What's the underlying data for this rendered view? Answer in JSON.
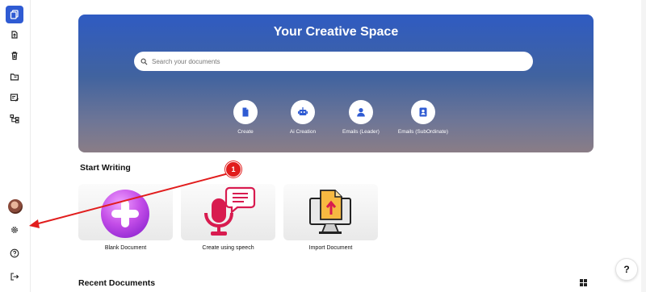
{
  "hero": {
    "title": "Your Creative Space",
    "search_placeholder": "Search your documents",
    "actions": [
      {
        "label": "Create",
        "icon": "document-icon"
      },
      {
        "label": "Ai Creation",
        "icon": "robot-icon"
      },
      {
        "label": "Emails (Leader)",
        "icon": "user-icon"
      },
      {
        "label": "Emails (SubOrdinate)",
        "icon": "contact-card-icon"
      }
    ]
  },
  "start_writing": {
    "title": "Start Writing",
    "cards": [
      {
        "label": "Blank Document"
      },
      {
        "label": "Create using speech"
      },
      {
        "label": "Import Document"
      }
    ]
  },
  "recent": {
    "title": "Recent Documents"
  },
  "help": {
    "label": "?"
  },
  "annotation": {
    "step": "1"
  },
  "colors": {
    "accent": "#2f5bd3",
    "annotation": "#e11d1d"
  }
}
